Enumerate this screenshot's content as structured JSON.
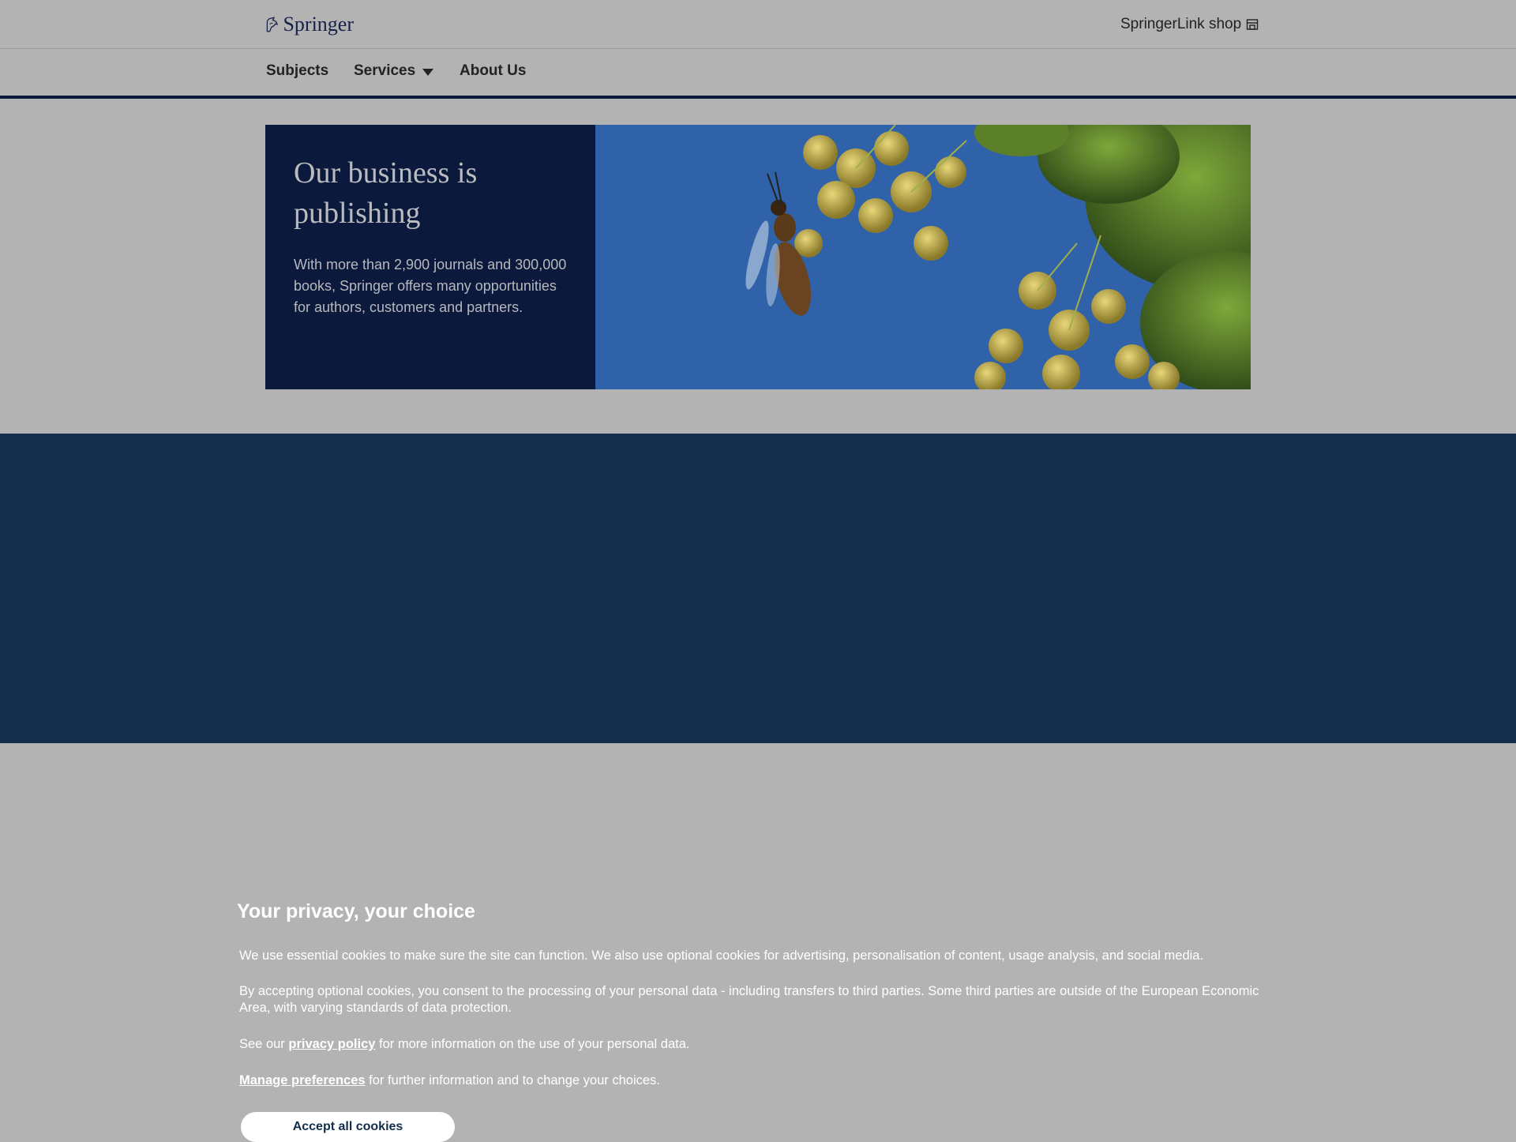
{
  "header": {
    "logo_text": "Springer",
    "shop_label": "SpringerLink shop",
    "shop_icon": "storefront-icon"
  },
  "nav": {
    "subjects": "Subjects",
    "services": "Services",
    "about": "About Us"
  },
  "hero": {
    "title": "Our business is publishing",
    "description": "With more than 2,900 journals and 300,000 books, Springer offers many opportunities for authors, customers and partners.",
    "image": "bee-on-flowers-photo"
  },
  "cookie_banner": {
    "title": "Your privacy, your choice",
    "p1": "We use essential cookies to make sure the site can function. We also use optional cookies for advertising, personalisation of content, usage analysis, and social media.",
    "p2": "By accepting optional cookies, you consent to the processing of your personal data - including transfers to third parties. Some third parties are outside of the European Economic Area, with varying standards of data protection.",
    "p3_prefix": "See our ",
    "privacy_link": "privacy policy",
    "p3_suffix": " for more information on the use of your personal data.",
    "manage_label": "Manage preferences",
    "p4_suffix": " for further information and to change your choices.",
    "accept_label": "Accept all cookies"
  },
  "colors": {
    "navy": "#0b1a3c",
    "banner_bg": "#132e4a",
    "overlay_gray": "#b3b3b3"
  }
}
